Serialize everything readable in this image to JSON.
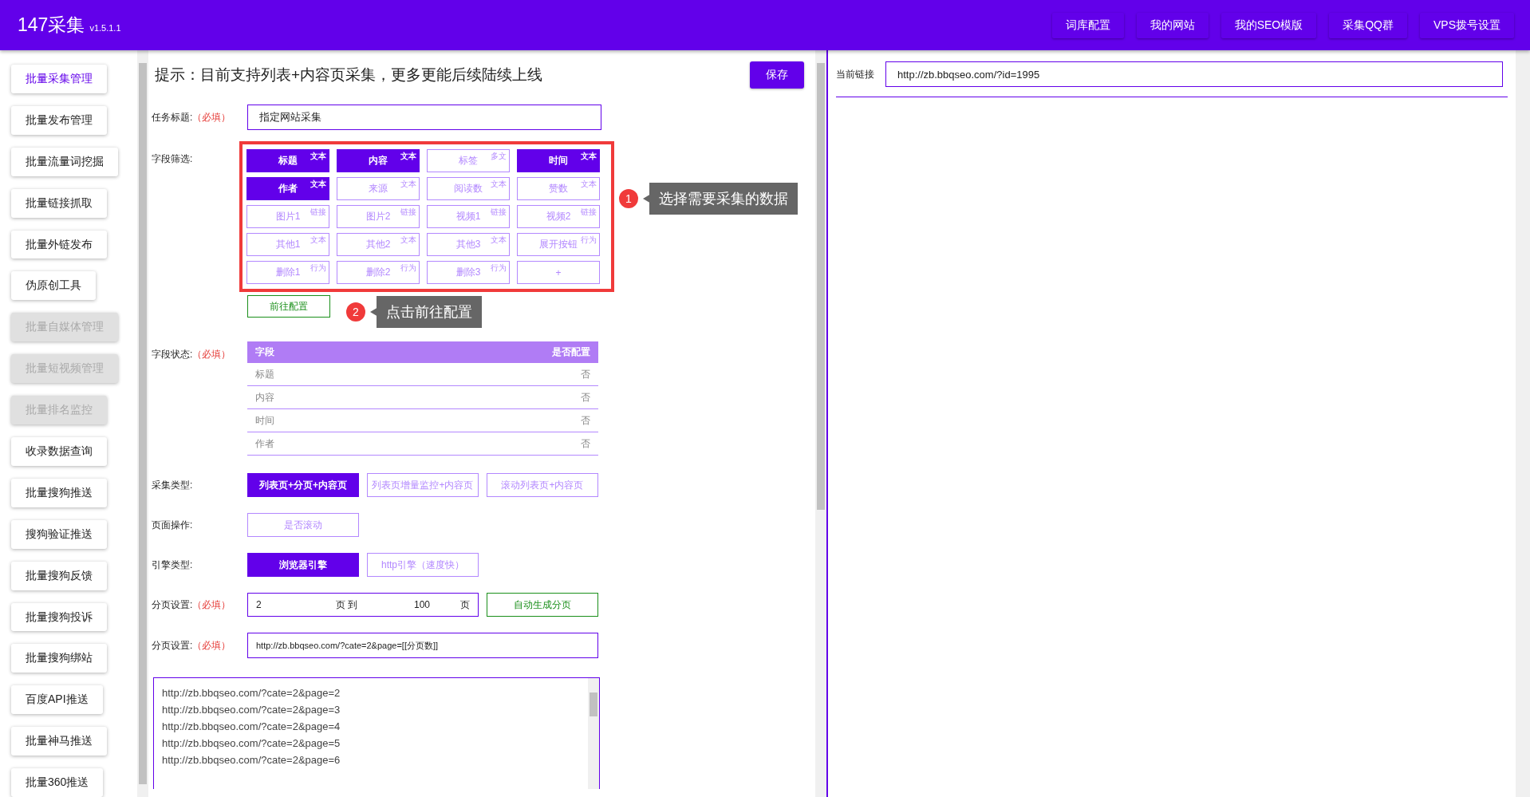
{
  "header": {
    "title": "147采集",
    "version": "v1.5.1.1",
    "nav": [
      {
        "label": "词库配置"
      },
      {
        "label": "我的网站"
      },
      {
        "label": "我的SEO模版"
      },
      {
        "label": "采集QQ群"
      },
      {
        "label": "VPS拨号设置"
      }
    ]
  },
  "sidebar": {
    "items": [
      {
        "label": "批量采集管理",
        "selected": true,
        "disabled": false
      },
      {
        "label": "批量发布管理",
        "selected": false,
        "disabled": false
      },
      {
        "label": "批量流量词挖掘",
        "selected": false,
        "disabled": false
      },
      {
        "label": "批量链接抓取",
        "selected": false,
        "disabled": false
      },
      {
        "label": "批量外链发布",
        "selected": false,
        "disabled": false
      },
      {
        "label": "伪原创工具",
        "selected": false,
        "disabled": false
      },
      {
        "label": "批量自媒体管理",
        "selected": false,
        "disabled": true
      },
      {
        "label": "批量短视频管理",
        "selected": false,
        "disabled": true
      },
      {
        "label": "批量排名监控",
        "selected": false,
        "disabled": true
      },
      {
        "label": "收录数据查询",
        "selected": false,
        "disabled": false
      },
      {
        "label": "批量搜狗推送",
        "selected": false,
        "disabled": false
      },
      {
        "label": "搜狗验证推送",
        "selected": false,
        "disabled": false
      },
      {
        "label": "批量搜狗反馈",
        "selected": false,
        "disabled": false
      },
      {
        "label": "批量搜狗投诉",
        "selected": false,
        "disabled": false
      },
      {
        "label": "批量搜狗绑站",
        "selected": false,
        "disabled": false
      },
      {
        "label": "百度API推送",
        "selected": false,
        "disabled": false
      },
      {
        "label": "批量神马推送",
        "selected": false,
        "disabled": false
      },
      {
        "label": "批量360推送",
        "selected": false,
        "disabled": false
      }
    ]
  },
  "main": {
    "hint": "提示：目前支持列表+内容页采集，更多更能后续陆续上线",
    "save_button": "保存",
    "task_title": {
      "label": "任务标题:",
      "required": "（必填）",
      "value": "指定网站采集"
    },
    "field_filter": {
      "label": "字段筛选:",
      "fields": [
        {
          "kind": "field",
          "label": "标题",
          "tag": "文本",
          "selected": true
        },
        {
          "kind": "field",
          "label": "内容",
          "tag": "文本",
          "selected": true
        },
        {
          "kind": "field",
          "label": "标签",
          "tag": "多文",
          "selected": false
        },
        {
          "kind": "field",
          "label": "时间",
          "tag": "文本",
          "selected": true
        },
        {
          "kind": "field",
          "label": "作者",
          "tag": "文本",
          "selected": true
        },
        {
          "kind": "field",
          "label": "来源",
          "tag": "文本",
          "selected": false
        },
        {
          "kind": "field",
          "label": "阅读数",
          "tag": "文本",
          "selected": false
        },
        {
          "kind": "field",
          "label": "赞数",
          "tag": "文本",
          "selected": false
        },
        {
          "kind": "field",
          "label": "图片1",
          "tag": "链接",
          "selected": false
        },
        {
          "kind": "field",
          "label": "图片2",
          "tag": "链接",
          "selected": false
        },
        {
          "kind": "field",
          "label": "视频1",
          "tag": "链接",
          "selected": false
        },
        {
          "kind": "field",
          "label": "视频2",
          "tag": "链接",
          "selected": false
        },
        {
          "kind": "field",
          "label": "其他1",
          "tag": "文本",
          "selected": false
        },
        {
          "kind": "field",
          "label": "其他2",
          "tag": "文本",
          "selected": false
        },
        {
          "kind": "field",
          "label": "其他3",
          "tag": "文本",
          "selected": false
        },
        {
          "kind": "field",
          "label": "展开按钮",
          "tag": "行为",
          "selected": false
        },
        {
          "kind": "field",
          "label": "删除1",
          "tag": "行为",
          "selected": false
        },
        {
          "kind": "field",
          "label": "删除2",
          "tag": "行为",
          "selected": false
        },
        {
          "kind": "field",
          "label": "删除3",
          "tag": "行为",
          "selected": false
        },
        {
          "kind": "add",
          "label": "+"
        }
      ],
      "config_button": "前往配置"
    },
    "annotations": [
      {
        "number": "1",
        "text": "选择需要采集的数据"
      },
      {
        "number": "2",
        "text": "点击前往配置"
      }
    ],
    "field_status": {
      "label": "字段状态:",
      "required": "（必填）",
      "columns": [
        "字段",
        "是否配置"
      ],
      "rows": [
        {
          "field": "标题",
          "configured": "否"
        },
        {
          "field": "内容",
          "configured": "否"
        },
        {
          "field": "时间",
          "configured": "否"
        },
        {
          "field": "作者",
          "configured": "否"
        }
      ]
    },
    "collect_type": {
      "label": "采集类型:",
      "options": [
        {
          "label": "列表页+分页+内容页",
          "selected": true
        },
        {
          "label": "列表页增量监控+内容页",
          "selected": false
        },
        {
          "label": "滚动列表页+内容页",
          "selected": false
        }
      ]
    },
    "page_action": {
      "label": "页面操作:",
      "options": [
        {
          "label": "是否滚动",
          "selected": false
        }
      ]
    },
    "engine_type": {
      "label": "引擎类型:",
      "options": [
        {
          "label": "浏览器引擎",
          "selected": true
        },
        {
          "label": "http引擎（速度快）",
          "selected": false
        }
      ]
    },
    "pagination": {
      "label": "分页设置:",
      "required": "（必填）",
      "from": "2",
      "between": "页 到",
      "to": "100",
      "unit": "页",
      "button": "自动生成分页"
    },
    "page_url": {
      "label": "分页设置:",
      "required": "（必填）",
      "value": "http://zb.bbqseo.com/?cate=2&page=[[分页数]]"
    },
    "url_list": [
      "http://zb.bbqseo.com/?cate=2&page=2",
      "http://zb.bbqseo.com/?cate=2&page=3",
      "http://zb.bbqseo.com/?cate=2&page=4",
      "http://zb.bbqseo.com/?cate=2&page=5",
      "http://zb.bbqseo.com/?cate=2&page=6"
    ]
  },
  "preview": {
    "label": "当前链接",
    "value": "http://zb.bbqseo.com/?id=1995"
  }
}
